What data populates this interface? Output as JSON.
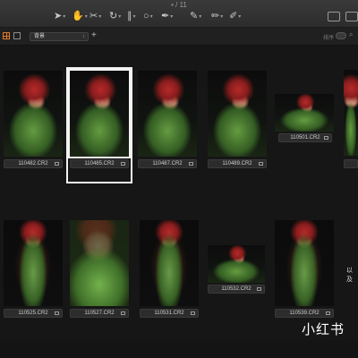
{
  "window": {
    "title": "• / 11"
  },
  "toolbar": {
    "tools": [
      {
        "name": "select-tool",
        "glyph": "➤"
      },
      {
        "name": "pan-tool",
        "glyph": "✋"
      },
      {
        "name": "crop-tool",
        "glyph": "✂"
      },
      {
        "name": "rotate-tool",
        "glyph": "↻"
      },
      {
        "name": "keystone-tool",
        "glyph": "∥"
      },
      {
        "name": "spot-tool",
        "glyph": "○"
      },
      {
        "name": "picker-tool",
        "glyph": "✒"
      },
      {
        "name": "brush-tool",
        "glyph": "✎"
      },
      {
        "name": "eraser-tool",
        "glyph": "✏"
      },
      {
        "name": "gradient-tool",
        "glyph": "✐"
      }
    ]
  },
  "browser": {
    "folder_label": "背景",
    "add_label": "+",
    "sort_label": "排序"
  },
  "thumbnails": [
    {
      "filename": "110482.CR2",
      "variant": "wide",
      "selected": false
    },
    {
      "filename": "110485.CR2",
      "variant": "wide",
      "selected": true
    },
    {
      "filename": "110487.CR2",
      "variant": "wide",
      "selected": false
    },
    {
      "filename": "110489.CR2",
      "variant": "wide",
      "selected": false
    },
    {
      "filename": "110501.CR2",
      "variant": "wide",
      "selected": false
    },
    {
      "filename": "",
      "variant": "wide",
      "selected": false
    },
    {
      "filename": "110525.CR2",
      "variant": "tall",
      "selected": false
    },
    {
      "filename": "110527.CR2",
      "variant": "close",
      "selected": false
    },
    {
      "filename": "110531.CR2",
      "variant": "tall",
      "selected": false
    },
    {
      "filename": "110532.CR2",
      "variant": "wide",
      "selected": false
    },
    {
      "filename": "110539.CR2",
      "variant": "tall",
      "selected": false
    }
  ],
  "side_text": "以及",
  "watermark": "小红书"
}
